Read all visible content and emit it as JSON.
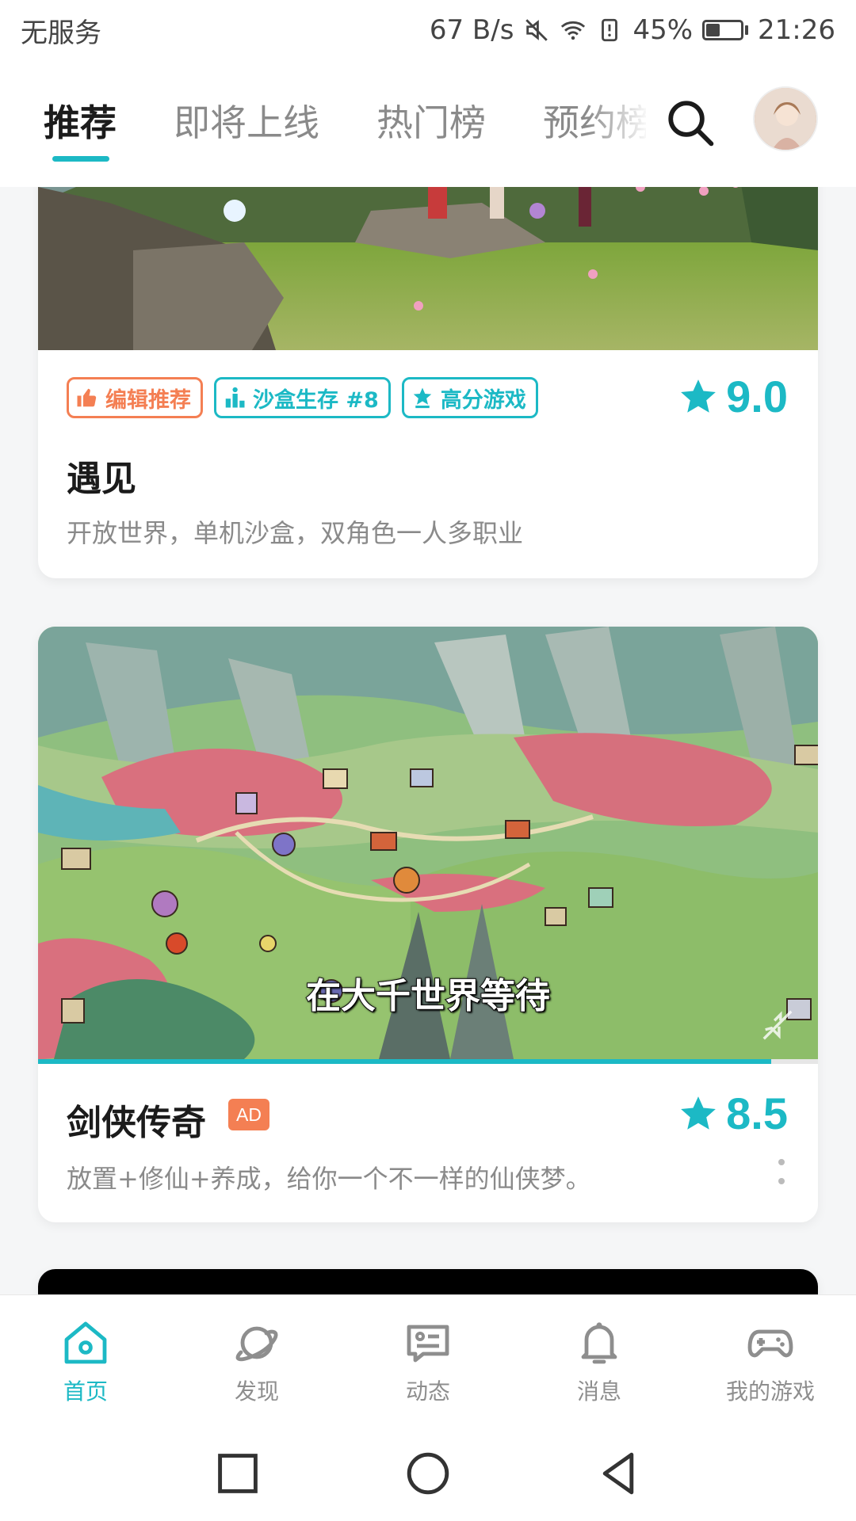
{
  "status_bar": {
    "carrier": "无服务",
    "net_speed": "67 B/s",
    "battery_percent": "45%",
    "battery_level": 0.45,
    "time": "21:26"
  },
  "top_tabs": {
    "items": [
      {
        "label": "推荐",
        "active": true
      },
      {
        "label": "即将上线",
        "active": false
      },
      {
        "label": "热门榜",
        "active": false
      },
      {
        "label": "预约榜",
        "active": false
      }
    ],
    "search_icon": "search-icon",
    "avatar": "user-avatar"
  },
  "feed": {
    "cards": [
      {
        "tags": [
          {
            "label": "编辑推荐",
            "icon": "thumbs-up-icon",
            "color": "#f47f53"
          },
          {
            "label": "沙盒生存 #8",
            "icon": "ranking-icon",
            "color": "#1cb9c5"
          },
          {
            "label": "高分游戏",
            "icon": "star-badge-icon",
            "color": "#1cb9c5"
          }
        ],
        "rating": "9.0",
        "title": "遇见",
        "description": "开放世界，单机沙盒，双角色一人多职业"
      },
      {
        "video_caption": "在大千世界等待",
        "video_progress": 0.94,
        "title": "剑侠传奇",
        "ad_label": "AD",
        "rating": "8.5",
        "description": "放置+修仙+养成，给你一个不一样的仙侠梦。"
      }
    ]
  },
  "bottom_nav": {
    "items": [
      {
        "label": "首页",
        "icon": "home-icon",
        "active": true
      },
      {
        "label": "发现",
        "icon": "planet-icon",
        "active": false
      },
      {
        "label": "动态",
        "icon": "feed-icon",
        "active": false
      },
      {
        "label": "消息",
        "icon": "bell-icon",
        "active": false
      },
      {
        "label": "我的游戏",
        "icon": "gamepad-icon",
        "active": false
      }
    ]
  },
  "colors": {
    "accent": "#1cb9c5",
    "tag_orange": "#f47f53"
  }
}
